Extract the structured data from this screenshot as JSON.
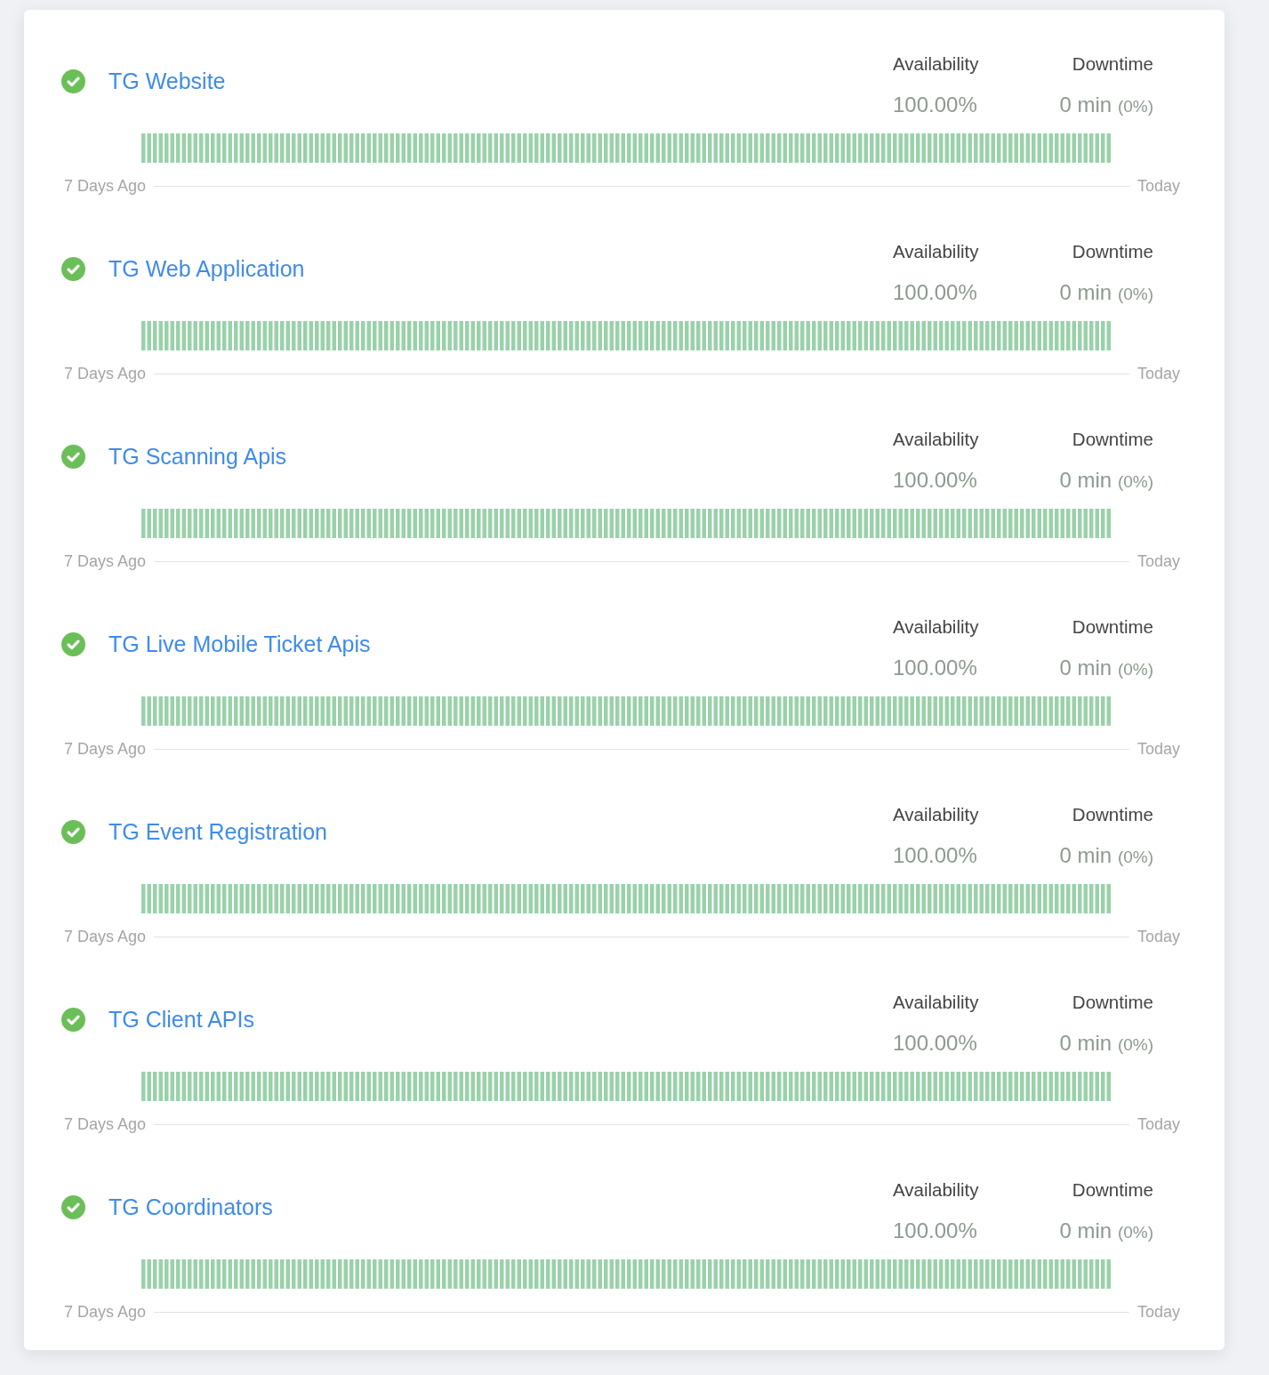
{
  "monitors": [
    {
      "name": "TG Website",
      "operational": true,
      "availability_label": "Availability",
      "availability": "100.00%",
      "downtime_label": "Downtime",
      "downtime": "0 min",
      "downtime_share": "(0%)",
      "range_start": "7 Days Ago",
      "range_end": "Today"
    },
    {
      "name": "TG Web Application",
      "operational": true,
      "availability_label": "Availability",
      "availability": "100.00%",
      "downtime_label": "Downtime",
      "downtime": "0 min",
      "downtime_share": "(0%)",
      "range_start": "7 Days Ago",
      "range_end": "Today"
    },
    {
      "name": "TG Scanning Apis",
      "operational": true,
      "availability_label": "Availability",
      "availability": "100.00%",
      "downtime_label": "Downtime",
      "downtime": "0 min",
      "downtime_share": "(0%)",
      "range_start": "7 Days Ago",
      "range_end": "Today"
    },
    {
      "name": "TG Live Mobile Ticket Apis",
      "operational": true,
      "availability_label": "Availability",
      "availability": "100.00%",
      "downtime_label": "Downtime",
      "downtime": "0 min",
      "downtime_share": "(0%)",
      "range_start": "7 Days Ago",
      "range_end": "Today"
    },
    {
      "name": "TG Event Registration",
      "operational": true,
      "availability_label": "Availability",
      "availability": "100.00%",
      "downtime_label": "Downtime",
      "downtime": "0 min",
      "downtime_share": "(0%)",
      "range_start": "7 Days Ago",
      "range_end": "Today"
    },
    {
      "name": "TG Client APIs",
      "operational": true,
      "availability_label": "Availability",
      "availability": "100.00%",
      "downtime_label": "Downtime",
      "downtime": "0 min",
      "downtime_share": "(0%)",
      "range_start": "7 Days Ago",
      "range_end": "Today"
    },
    {
      "name": "TG Coordinators",
      "operational": true,
      "availability_label": "Availability",
      "availability": "100.00%",
      "downtime_label": "Downtime",
      "downtime": "0 min",
      "downtime_share": "(0%)",
      "range_start": "7 Days Ago",
      "range_end": "Today"
    }
  ]
}
